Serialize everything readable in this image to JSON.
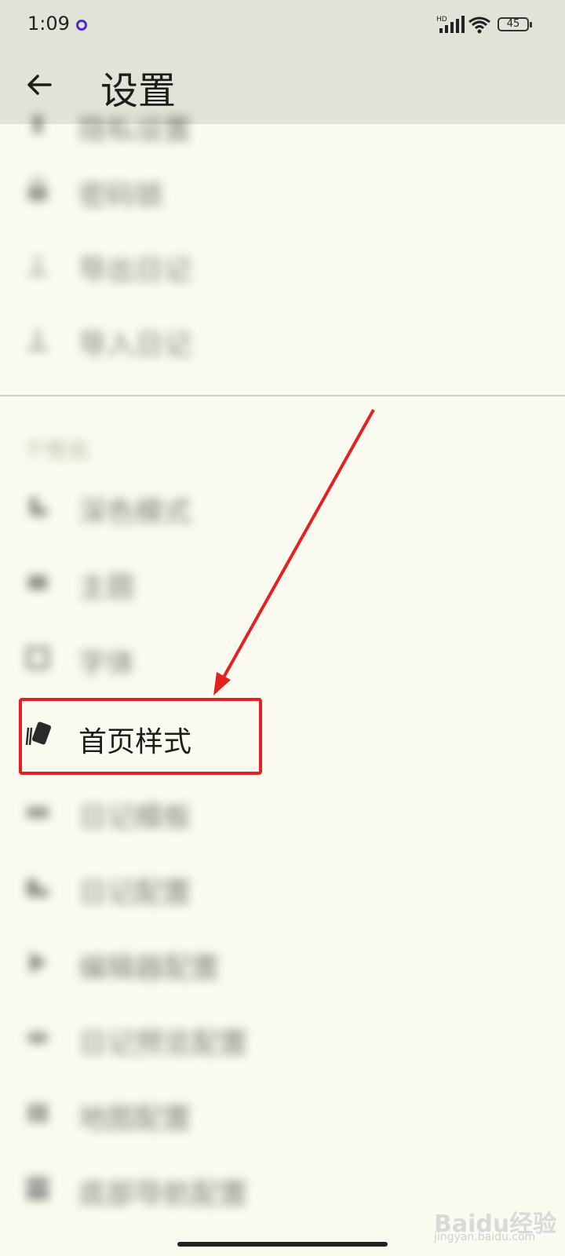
{
  "status": {
    "time": "1:09",
    "battery": "45",
    "network": "HD"
  },
  "header": {
    "title": "设置"
  },
  "items_top": [
    {
      "label": "隐私设置",
      "icon": "key-icon"
    },
    {
      "label": "密码锁",
      "icon": "lock-icon"
    },
    {
      "label": "导出日记",
      "icon": "export-icon"
    },
    {
      "label": "导入日记",
      "icon": "import-icon"
    }
  ],
  "section": {
    "label": "个性化"
  },
  "items_personal": [
    {
      "label": "深色模式",
      "icon": "moon-icon"
    },
    {
      "label": "主题",
      "icon": "palette-icon"
    },
    {
      "label": "字体",
      "icon": "font-icon"
    },
    {
      "label": "首页样式",
      "icon": "cards-icon"
    },
    {
      "label": "日记模板",
      "icon": "template-icon"
    },
    {
      "label": "日记配置",
      "icon": "folder-icon"
    },
    {
      "label": "编辑器配置",
      "icon": "editor-icon"
    },
    {
      "label": "日记预览配置",
      "icon": "eye-icon"
    },
    {
      "label": "地图配置",
      "icon": "map-icon"
    },
    {
      "label": "底部导航配置",
      "icon": "grid-icon"
    }
  ],
  "watermark": {
    "brand": "Baidu经验",
    "url": "jingyan.baidu.com"
  },
  "colors": {
    "accent": "#e3211e",
    "background": "#fafaf0",
    "appbar": "#e2e3d8"
  }
}
